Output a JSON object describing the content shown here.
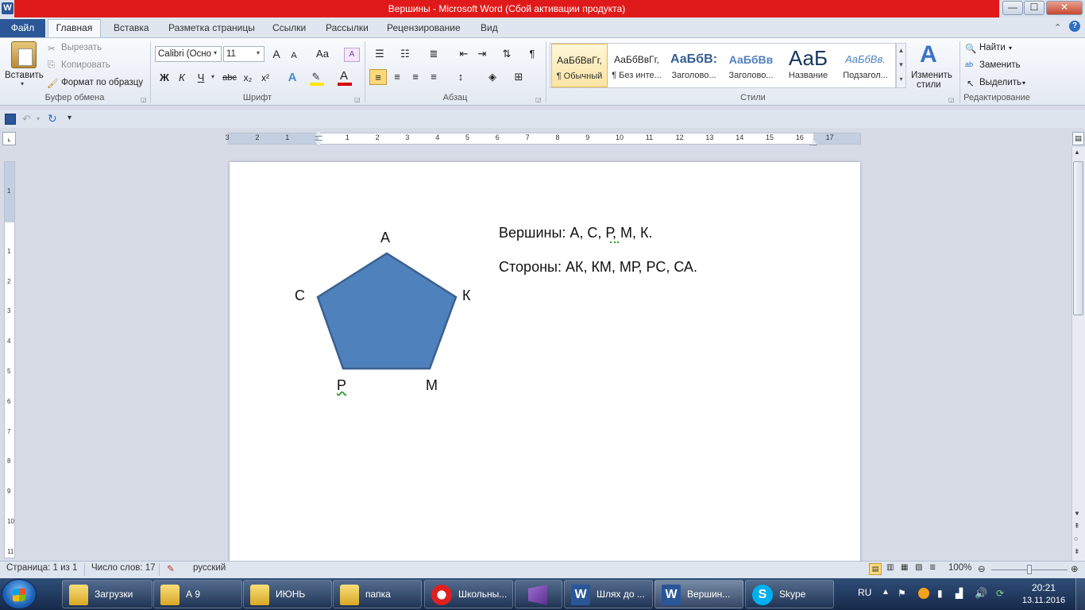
{
  "window": {
    "title": "Вершины  -  Microsoft Word (Сбой активации продукта)",
    "app_icon": "W",
    "controls": {
      "minimize": "—",
      "maximize": "☐",
      "close": "✕"
    }
  },
  "ribbon_tabs": [
    "Файл",
    "Главная",
    "Вставка",
    "Разметка страницы",
    "Ссылки",
    "Рассылки",
    "Рецензирование",
    "Вид"
  ],
  "clipboard": {
    "paste": "Вставить",
    "cut": "Вырезать",
    "copy": "Копировать",
    "format_painter": "Формат по образцу",
    "label": "Буфер обмена"
  },
  "font": {
    "name": "Calibri (Осно",
    "size": "11",
    "label": "Шрифт",
    "grow": "A",
    "shrink": "A",
    "case": "Aa",
    "bold": "Ж",
    "italic": "К",
    "underline": "Ч",
    "strike": "abc",
    "sub": "x₂",
    "sup": "x²"
  },
  "paragraph": {
    "label": "Абзац",
    "pilcrow": "¶"
  },
  "styles": {
    "label": "Стили",
    "items": [
      {
        "sample": "АаБбВвГг,",
        "name": "¶ Обычный"
      },
      {
        "sample": "АаБбВвГг,",
        "name": "¶ Без инте..."
      },
      {
        "sample": "АаБбВ:",
        "name": "Заголово..."
      },
      {
        "sample": "АаБбВв",
        "name": "Заголово..."
      },
      {
        "sample": "АаБ",
        "name": "Название"
      },
      {
        "sample": "АаБбВв.",
        "name": "Подзагол..."
      }
    ],
    "change_line1": "Изменить",
    "change_line2": "стили"
  },
  "editing": {
    "label": "Редактирование",
    "find": "Найти",
    "replace": "Заменить",
    "select": "Выделить"
  },
  "ruler": {
    "h_ticks": [
      "3",
      "2",
      "1",
      "1",
      "2",
      "3",
      "4",
      "5",
      "6",
      "7",
      "8",
      "9",
      "10",
      "11",
      "12",
      "13",
      "14",
      "15",
      "16",
      "17"
    ],
    "v_ticks": [
      "1",
      "1",
      "2",
      "3",
      "4",
      "5",
      "6",
      "7",
      "8",
      "9",
      "10",
      "11"
    ]
  },
  "document": {
    "vertices": [
      "А",
      "С",
      "К",
      "Р",
      "М"
    ],
    "line1": "Вершины:  А, С, Р, М, К.",
    "line2": "Стороны: АК, КМ, МР, РС, СА.",
    "shape_color": "#4f81bd",
    "shape_stroke": "#3a6190"
  },
  "status": {
    "page": "Страница: 1 из 1",
    "words": "Число слов: 17",
    "language": "русский",
    "zoom": "100%"
  },
  "taskbar": {
    "items": [
      {
        "label": "Загрузки",
        "icon": "folder-icon"
      },
      {
        "label": "А 9",
        "icon": "folder-icon"
      },
      {
        "label": "ИЮНЬ",
        "icon": "folder-icon"
      },
      {
        "label": "папка",
        "icon": "folder-icon"
      },
      {
        "label": "Школьны...",
        "icon": "yandex-icon"
      },
      {
        "label": "",
        "icon": "visual-studio-icon"
      },
      {
        "label": "Шлях до ...",
        "icon": "word-icon"
      },
      {
        "label": "Вершин...",
        "icon": "word-icon"
      },
      {
        "label": "Skype",
        "icon": "skype-icon"
      }
    ],
    "lang": "RU",
    "time": "20:21",
    "date": "13.11.2016"
  }
}
